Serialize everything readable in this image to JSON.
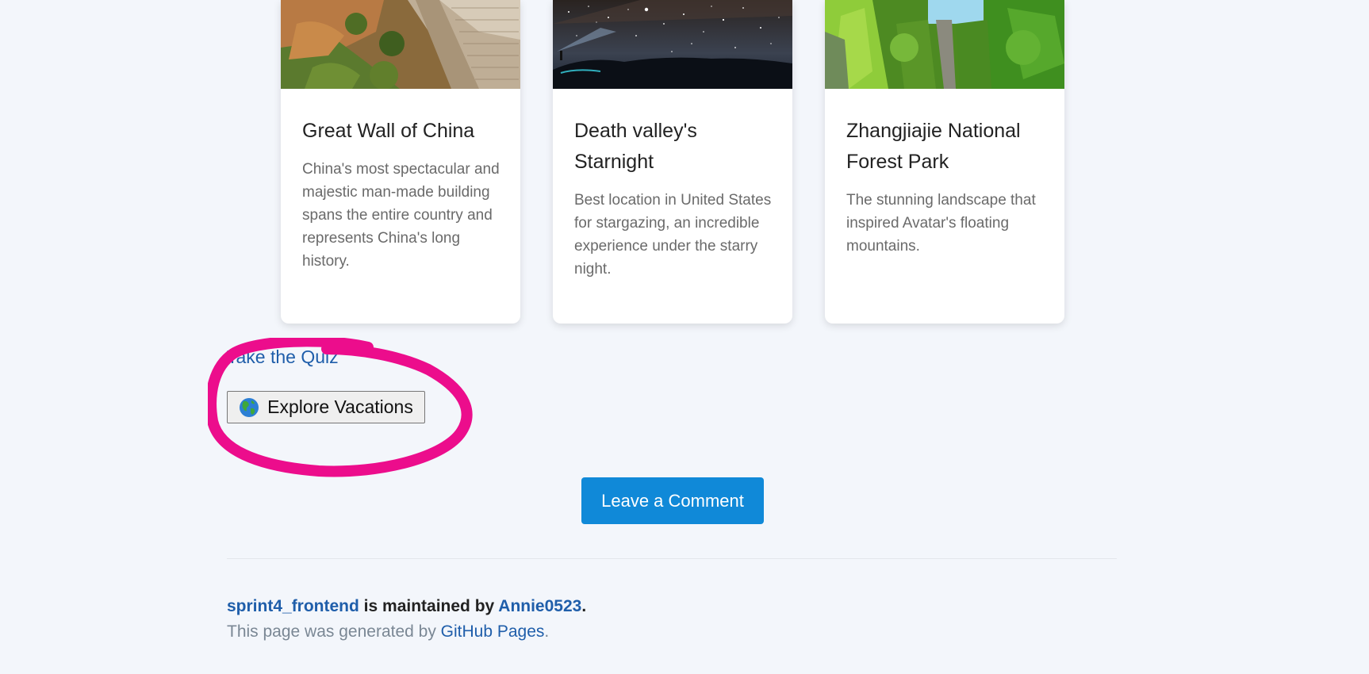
{
  "cards": [
    {
      "image": "great-wall-photo",
      "title": "Great Wall of China",
      "description": "China's most spectacular and majestic man-made building spans the entire country and represents China's long history."
    },
    {
      "image": "death-valley-starnight-photo",
      "title": "Death valley's Starnight",
      "description": "Best location in United States for stargazing, an incredible experience under the starry night."
    },
    {
      "image": "zhangjiajie-forest-photo",
      "title": "Zhangjiajie National Forest Park",
      "description": "The stunning landscape that inspired Avatar's floating mountains."
    }
  ],
  "quiz_link": "Take the Quiz",
  "explore_button": {
    "icon": "globe-icon",
    "label": "Explore Vacations"
  },
  "annotation": {
    "color": "#ec0d8c",
    "shape": "hand-drawn-circle"
  },
  "comment_button": "Leave a Comment",
  "footer": {
    "repo_link": "sprint4_frontend",
    "maintained_text": " is maintained by ",
    "user_link": "Annie0523",
    "period": ".",
    "generated_text": "This page was generated by ",
    "pages_link": "GitHub Pages",
    "period2": "."
  },
  "colors": {
    "background": "#f3f6fb",
    "link": "#1f5eaa",
    "primary_button": "#1089d8",
    "annotation": "#ec0d8c"
  }
}
